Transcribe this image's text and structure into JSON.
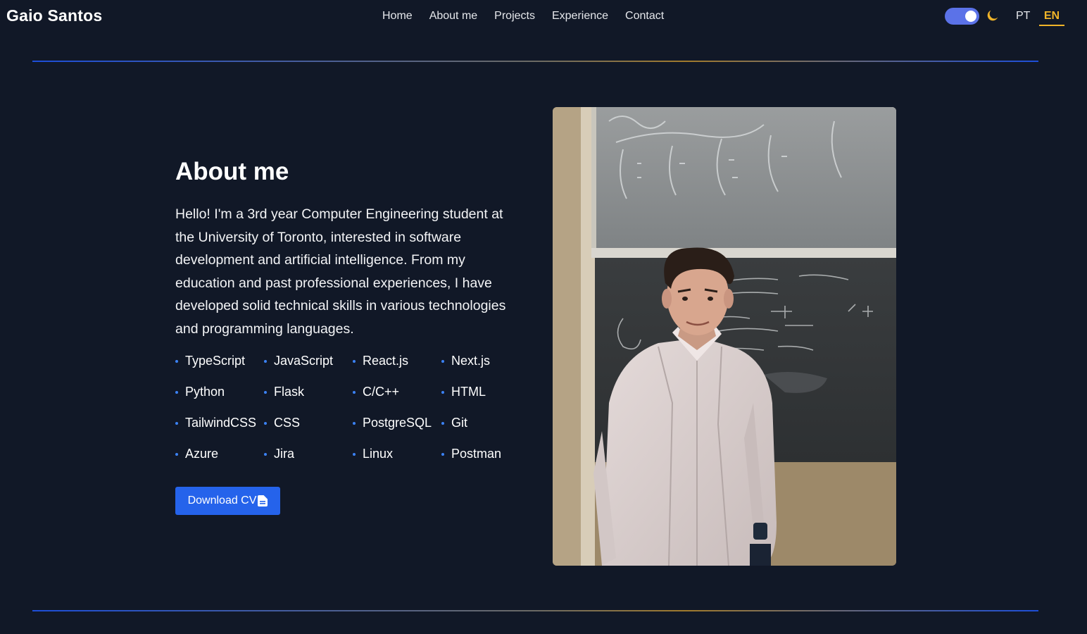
{
  "header": {
    "brand": "Gaio Santos",
    "nav": [
      "Home",
      "About me",
      "Projects",
      "Experience",
      "Contact"
    ],
    "theme_toggle_on": true,
    "theme_icon": "moon-icon",
    "languages": {
      "pt": "PT",
      "en": "EN"
    },
    "active_language": "EN",
    "accent_color": "#f0b429"
  },
  "about": {
    "title": "About me",
    "description": "Hello! I'm a 3rd year Computer Engineering student at the University of Toronto, interested in software development and artificial intelligence. From my education and past professional experiences, I have developed solid technical skills in various technologies and programming languages.",
    "skills": [
      "TypeScript",
      "JavaScript",
      "React.js",
      "Next.js",
      "Python",
      "Flask",
      "C/C++",
      "HTML",
      "TailwindCSS",
      "CSS",
      "PostgreSQL",
      "Git",
      "Azure",
      "Jira",
      "Linux",
      "Postman"
    ],
    "cv_button": "Download CV",
    "cv_icon": "document-icon"
  },
  "colors": {
    "background": "#111827",
    "primary": "#2563eb",
    "toggle": "#5b72e8"
  }
}
